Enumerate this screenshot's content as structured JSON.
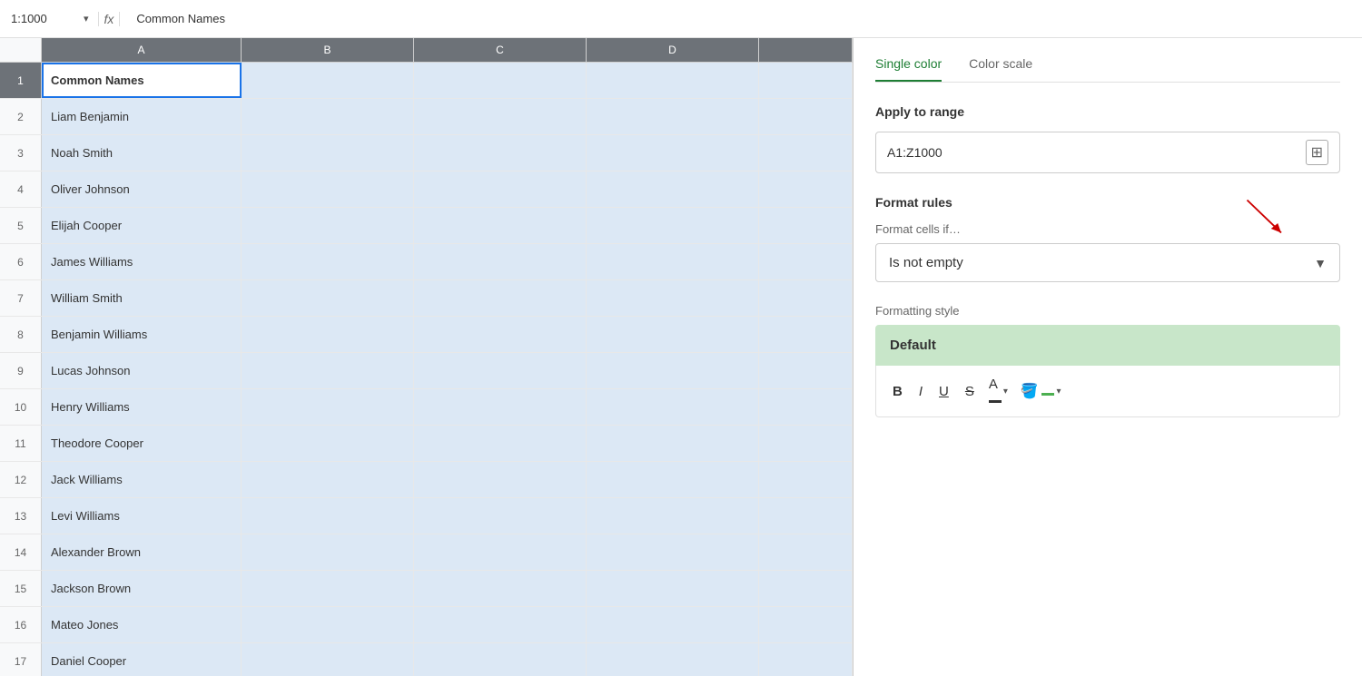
{
  "formula_bar": {
    "cell_ref": "1:1000",
    "fx_label": "fx",
    "formula_value": "Common Names"
  },
  "spreadsheet": {
    "columns": [
      "A",
      "B",
      "C",
      "D"
    ],
    "rows": [
      {
        "num": 1,
        "a": "Common Names",
        "b": "",
        "c": "",
        "d": ""
      },
      {
        "num": 2,
        "a": "Liam Benjamin",
        "b": "",
        "c": "",
        "d": ""
      },
      {
        "num": 3,
        "a": "Noah Smith",
        "b": "",
        "c": "",
        "d": ""
      },
      {
        "num": 4,
        "a": "Oliver Johnson",
        "b": "",
        "c": "",
        "d": ""
      },
      {
        "num": 5,
        "a": "Elijah Cooper",
        "b": "",
        "c": "",
        "d": ""
      },
      {
        "num": 6,
        "a": "James Williams",
        "b": "",
        "c": "",
        "d": ""
      },
      {
        "num": 7,
        "a": "William Smith",
        "b": "",
        "c": "",
        "d": ""
      },
      {
        "num": 8,
        "a": "Benjamin Williams",
        "b": "",
        "c": "",
        "d": ""
      },
      {
        "num": 9,
        "a": "Lucas Johnson",
        "b": "",
        "c": "",
        "d": ""
      },
      {
        "num": 10,
        "a": "Henry Williams",
        "b": "",
        "c": "",
        "d": ""
      },
      {
        "num": 11,
        "a": "Theodore Cooper",
        "b": "",
        "c": "",
        "d": ""
      },
      {
        "num": 12,
        "a": "Jack Williams",
        "b": "",
        "c": "",
        "d": ""
      },
      {
        "num": 13,
        "a": "Levi Williams",
        "b": "",
        "c": "",
        "d": ""
      },
      {
        "num": 14,
        "a": "Alexander Brown",
        "b": "",
        "c": "",
        "d": ""
      },
      {
        "num": 15,
        "a": "Jackson Brown",
        "b": "",
        "c": "",
        "d": ""
      },
      {
        "num": 16,
        "a": "Mateo Jones",
        "b": "",
        "c": "",
        "d": ""
      },
      {
        "num": 17,
        "a": "Daniel Cooper",
        "b": "",
        "c": "",
        "d": ""
      }
    ]
  },
  "right_panel": {
    "tabs": [
      {
        "label": "Single color",
        "active": true
      },
      {
        "label": "Color scale",
        "active": false
      }
    ],
    "apply_to_range": {
      "label": "Apply to range",
      "value": "A1:Z1000",
      "grid_icon": "⊞"
    },
    "format_rules": {
      "label": "Format rules",
      "cells_if_label": "Format cells if…",
      "condition": "Is not empty",
      "dropdown_arrow": "▼"
    },
    "formatting_style": {
      "label": "Formatting style",
      "preview_text": "Default",
      "toolbar": {
        "bold": "B",
        "italic": "I",
        "underline": "U",
        "strikethrough": "S",
        "font_color_label": "A",
        "fill_color_label": "🪣"
      }
    }
  }
}
